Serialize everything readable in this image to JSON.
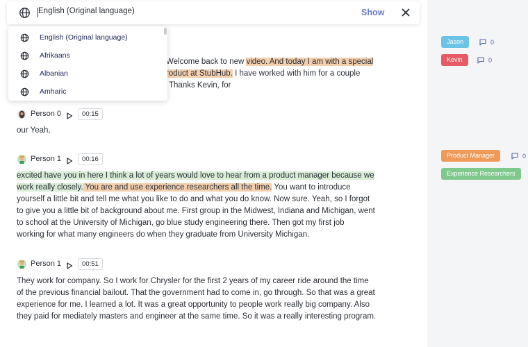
{
  "language_bar": {
    "value": "English (Original language)",
    "show_label": "Show"
  },
  "language_dropdown": {
    "options": [
      {
        "label": "English (Original language)"
      },
      {
        "label": "Afrikaans"
      },
      {
        "label": "Albanian"
      },
      {
        "label": "Amharic"
      }
    ]
  },
  "transcript": {
    "intro_lines": [
      {
        "plain_before": "Welcome back to new ",
        "highlight": "video. And today I am with a special",
        "plain_after": ""
      },
      {
        "plain_before": "",
        "highlight": "roduct at StubHub.",
        "plain_after": " I have worked with him for a couple"
      },
      {
        "plain_before": "Thanks Kevin, for",
        "highlight": "",
        "plain_after": ""
      }
    ],
    "segments": [
      {
        "speaker": "Person 0",
        "timestamp": "00:15",
        "lines": [
          "our Yeah,"
        ]
      },
      {
        "speaker": "Person 1",
        "timestamp": "00:16",
        "line1": "excited have you in here I think a lot of years would love to hear from a product manager because we",
        "line2_green": "work really closely.",
        "line2_orange": " You are and use experience researchers all the time.",
        "line2_plain": " You want to introduce",
        "lines_rest": [
          "yourself a little bit and tell me what you like to do and what you do know. Now sure. Yeah, so I forgot",
          "to give you a little bit of background about me. First group in the Midwest, Indiana and Michigan, went",
          "to school at the University of Michigan, go blue study engineering there. Then got my first job",
          "working for what many engineers do when they graduate from University Michigan."
        ]
      },
      {
        "speaker": "Person 1",
        "timestamp": "00:51",
        "lines": [
          "They work for company. So I work for Chrysler for the first 2 years of my career ride around the time",
          "of the previous financial bailout. That the government had to come in, go through. So that was a great",
          "experience for me. I learned a lot. It was a great opportunity to people work really big company. Also",
          "they paid for mediately masters and engineer at the same time. So it was a really interesting program."
        ]
      }
    ]
  },
  "side_panel": {
    "speaker_tags": [
      {
        "label": "Jason",
        "color": "#6cc3e8",
        "comments": "0"
      },
      {
        "label": "Kevin",
        "color": "#e65b66",
        "comments": "0"
      }
    ],
    "highlight_tags": [
      {
        "label": "Product Manager",
        "color": "#f09a5a",
        "comments": "0"
      },
      {
        "label": "Experience Researchers",
        "color": "#7fc98c"
      }
    ]
  },
  "colors": {
    "accent": "#6b78c7",
    "highlight_orange": "#f3cfae",
    "highlight_green": "#d8ecd6"
  }
}
